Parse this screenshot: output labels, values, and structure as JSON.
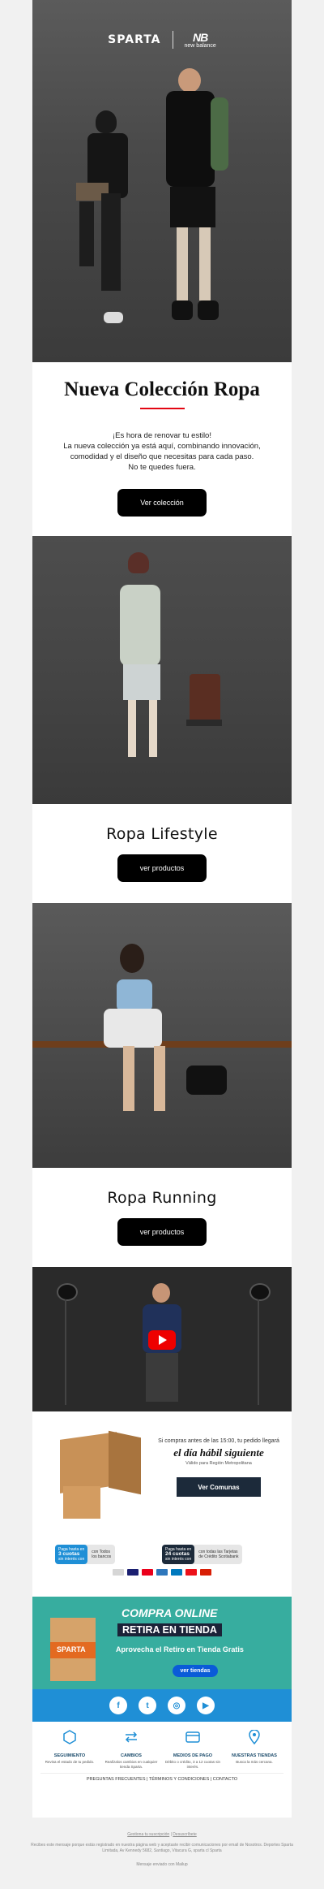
{
  "brand": {
    "sparta": "SPARTA",
    "nb": "new balance",
    "nb_mark": "NB"
  },
  "hero": {
    "title": "Nueva Colección Ropa",
    "line1": "¡Es hora de renovar tu estilo!",
    "line2": "La nueva colección ya está aquí, combinando innovación,",
    "line3": "comodidad y el diseño que necesitas para cada paso.",
    "line4": "No te quedes fuera.",
    "button": "Ver colección"
  },
  "lifestyle": {
    "title": "Ropa Lifestyle",
    "button": "ver productos"
  },
  "running": {
    "title": "Ropa Running",
    "button": "ver productos"
  },
  "shipping": {
    "small": "Si compras antes de las 15:00, tu pedido llegará",
    "big": "el día hábil siguiente",
    "tiny": "Válido para Región Metropolitana",
    "button": "Ver Comunas"
  },
  "payments": {
    "chip1_dark": [
      "Paga hasta en",
      "3 cuotas",
      "sin interés con"
    ],
    "chip1_light": [
      "con Todos",
      "los bancos"
    ],
    "chip2_dark": [
      "Paga hasta en",
      "24 cuotas",
      "sin interés con"
    ],
    "chip2_light": [
      "con todas las Tarjetas",
      "de Crédito Scotiabank"
    ],
    "cards": [
      "webpay",
      "VISA",
      "mastercard",
      "AMEX",
      "Diners",
      "Scotiabank",
      "redcompra"
    ]
  },
  "pickup": {
    "line1": "COMPRA ONLINE",
    "line2": "RETIRA EN TIENDA",
    "line3": "Aprovecha el Retiro en Tienda Gratis",
    "button": "ver tiendas",
    "bag": "SPARTA"
  },
  "features": [
    {
      "title": "SEGUIMIENTO",
      "desc": "Revisa el estado de tu pedido."
    },
    {
      "title": "CAMBIOS",
      "desc": "Realízalos cambios en cualquier tienda Sparta."
    },
    {
      "title": "MEDIOS DE PAGO",
      "desc": "Débito o crédito, 3 a 12 cuotas sin interés."
    },
    {
      "title": "NUESTRAS TIENDAS",
      "desc": "Busca la más cercana."
    }
  ],
  "links": "PREGUNTAS FRECUENTES   |   TÉRMINOS Y CONDICIONES   |   CONTACTO",
  "footer": {
    "manage": "Gestiona tu suscripción",
    "unsub": "Desuscríbete",
    "legal": "Recibes este mensaje porque estás registrado en nuestra página web y aceptaste recibir comunicaciones por email de Nosotros. Deportes Sparta Limitada, Av Kennedy 5682, Santiago, Vitacura G, sparta cl Sparta",
    "sent": "Mensaje enviado con Mailup"
  },
  "colors": {
    "accent_red": "#e30613",
    "teal": "#37ad9f",
    "blue": "#1f8fd6",
    "navy": "#1c2a3a"
  }
}
